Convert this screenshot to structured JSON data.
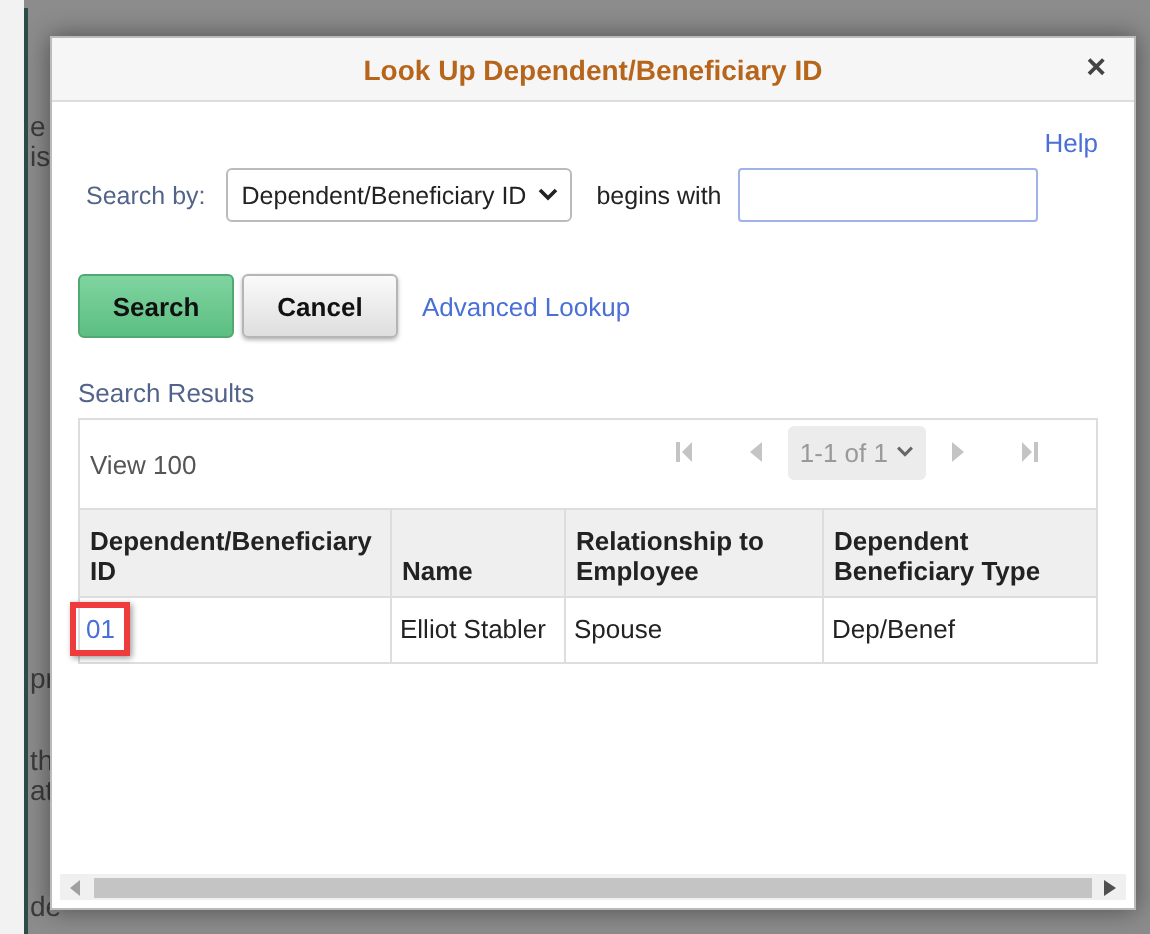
{
  "background": {
    "left_fragments": [
      "e",
      "is",
      "pr",
      "th",
      "at",
      "de"
    ]
  },
  "dialog": {
    "title": "Look Up Dependent/Beneficiary ID",
    "close": "×",
    "help": "Help",
    "search_by_label": "Search by:",
    "search_by_value": "Dependent/Beneficiary ID",
    "operator": "begins with",
    "buttons": [
      {
        "label": "Search",
        "kind": "primary"
      },
      {
        "label": "Cancel",
        "kind": "secondary"
      }
    ],
    "advanced_link": "Advanced Lookup",
    "results": {
      "title": "Search Results",
      "view": "View 100",
      "pager": "1-1 of 1",
      "columns": [
        "Dependent/Beneficiary ID",
        "Name",
        "Relationship to Employee",
        "Dependent Beneficiary Type"
      ],
      "rows": [
        {
          "cells": [
            "01",
            "Elliot Stabler",
            "Spouse",
            "Dep/Benef"
          ],
          "highlighted": true
        }
      ]
    }
  }
}
